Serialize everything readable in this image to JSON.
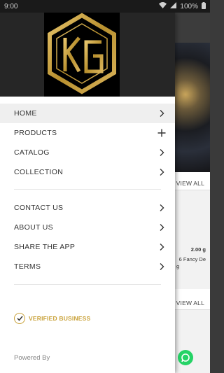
{
  "status": {
    "time": "9:00",
    "battery": "100%"
  },
  "menu": {
    "primary": [
      {
        "label": "HOME",
        "icon": "chevron-right-icon"
      },
      {
        "label": "PRODUCTS",
        "icon": "plus-icon"
      },
      {
        "label": "CATALOG",
        "icon": "chevron-right-icon"
      },
      {
        "label": "COLLECTION",
        "icon": "chevron-right-icon"
      }
    ],
    "secondary": [
      {
        "label": "CONTACT US",
        "icon": "chevron-right-icon"
      },
      {
        "label": "ABOUT US",
        "icon": "chevron-right-icon"
      },
      {
        "label": "SHARE THE APP",
        "icon": "chevron-right-icon"
      },
      {
        "label": "TERMS",
        "icon": "chevron-right-icon"
      }
    ]
  },
  "verified": {
    "label": "VERIFIED BUSINESS"
  },
  "footer": {
    "powered_by": "Powered By"
  },
  "background": {
    "view_all_1": "VIEW ALL",
    "product_weight": "2.00 g",
    "product_name_fragment": "6 Fancy De",
    "product_name_fragment_2": "g",
    "view_all_2": "VIEW ALL"
  },
  "colors": {
    "gold": "#c9a23a",
    "drawer_header": "#262626",
    "active_row": "#efefef",
    "whatsapp": "#25d366"
  }
}
